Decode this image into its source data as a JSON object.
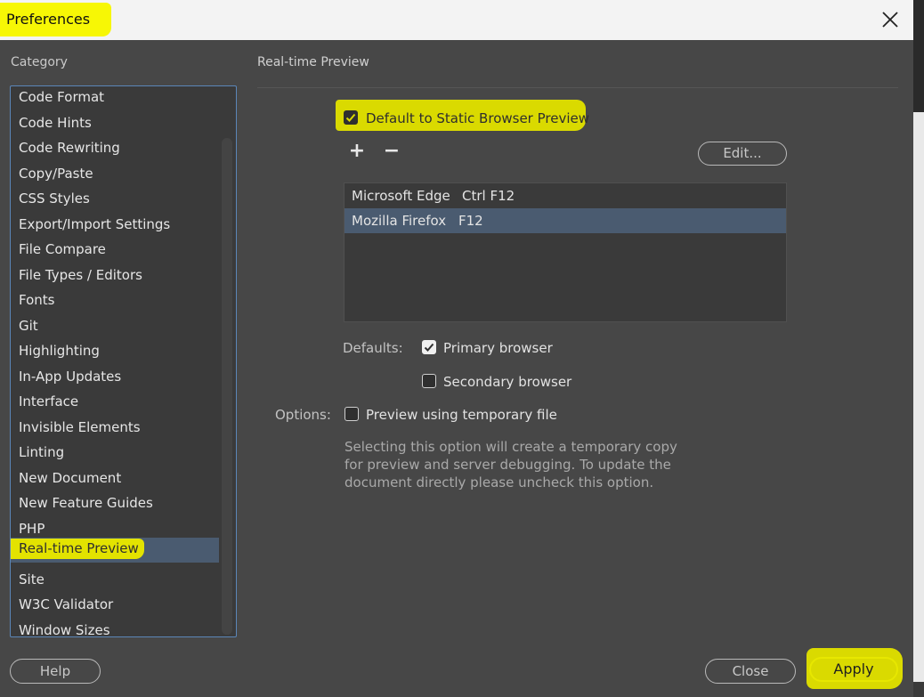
{
  "window": {
    "title": "Preferences"
  },
  "category": {
    "label": "Category",
    "items": [
      "Code Format",
      "Code Hints",
      "Code Rewriting",
      "Copy/Paste",
      "CSS Styles",
      "Export/Import Settings",
      "File Compare",
      "File Types / Editors",
      "Fonts",
      "Git",
      "Highlighting",
      "In-App Updates",
      "Interface",
      "Invisible Elements",
      "Linting",
      "New Document",
      "New Feature Guides",
      "PHP",
      "Real-time Preview",
      "Site",
      "W3C Validator",
      "Window Sizes"
    ],
    "selected_index": 18
  },
  "panel": {
    "title": "Real-time Preview",
    "static_preview": {
      "label": "Default to Static Browser Preview",
      "checked": true
    },
    "add_glyph": "+",
    "remove_glyph": "−",
    "edit_label": "Edit...",
    "browsers": [
      {
        "name": "Microsoft Edge",
        "key": "Ctrl F12",
        "selected": false
      },
      {
        "name": "Mozilla Firefox",
        "key": "F12",
        "selected": true
      }
    ],
    "defaults_label": "Defaults:",
    "primary": {
      "label": "Primary browser",
      "checked": true
    },
    "secondary": {
      "label": "Secondary browser",
      "checked": false
    },
    "options_label": "Options:",
    "temp_file": {
      "label": "Preview using temporary file",
      "checked": false
    },
    "description_lines": [
      "Selecting this option will create a temporary copy",
      "for preview and server debugging. To update the",
      "document directly please uncheck this option."
    ]
  },
  "footer": {
    "help_label": "Help",
    "close_label": "Close",
    "apply_label": "Apply"
  },
  "colors": {
    "highlight": "#dada00",
    "selection": "#4a5b70",
    "focus_border": "#5b86b8"
  }
}
